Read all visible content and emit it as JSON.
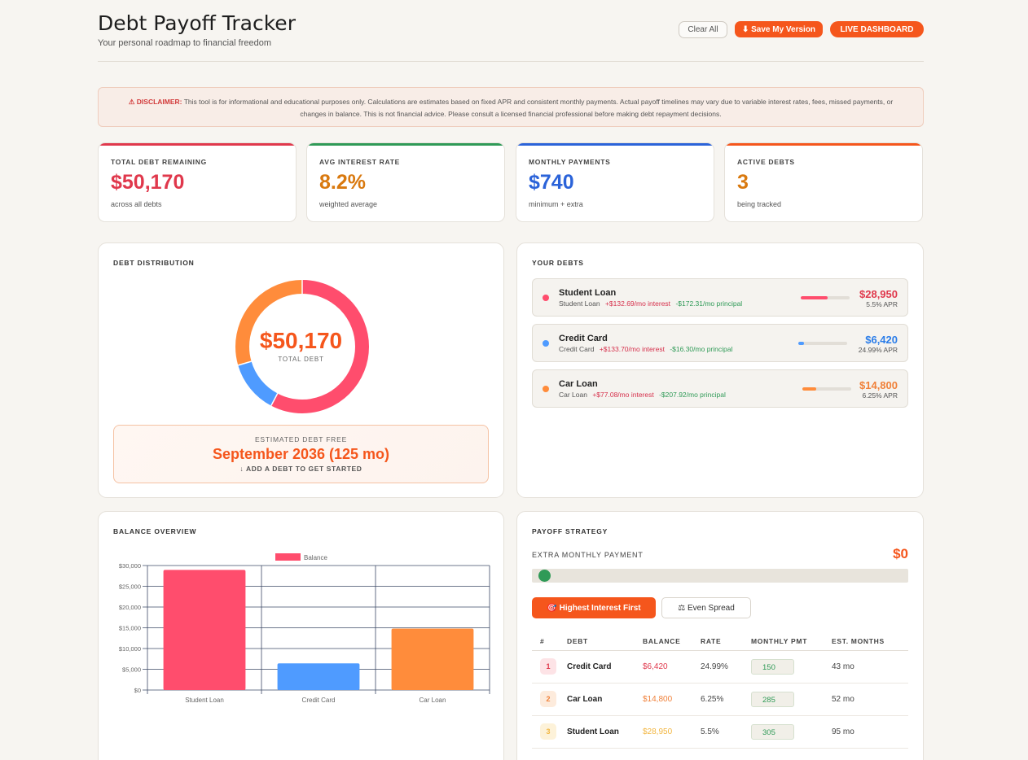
{
  "header": {
    "title": "Debt Payoff Tracker",
    "subtitle": "Your personal roadmap to financial freedom",
    "clear_label": "Clear All",
    "save_label": "⬇ Save My Version",
    "live_label": "LIVE DASHBOARD"
  },
  "disclaimer": {
    "lead": "⚠ DISCLAIMER:",
    "text": "This tool is for informational and educational purposes only. Calculations are estimates based on fixed APR and consistent monthly payments. Actual payoff timelines may vary due to variable interest rates, fees, missed payments, or changes in balance. This is not financial advice. Please consult a licensed financial professional before making debt repayment decisions."
  },
  "stats": [
    {
      "label": "TOTAL DEBT REMAINING",
      "value": "$50,170",
      "sub": "across all debts",
      "color": "#e0384c"
    },
    {
      "label": "AVG INTEREST RATE",
      "value": "8.2%",
      "sub": "weighted average",
      "color": "#d9790f"
    },
    {
      "label": "MONTHLY PAYMENTS",
      "value": "$740",
      "sub": "minimum + extra",
      "color": "#2b63d9"
    },
    {
      "label": "ACTIVE DEBTS",
      "value": "3",
      "sub": "being tracked",
      "color": "#d9790f"
    }
  ],
  "stat_bar_colors": [
    "#e0384c",
    "#2f9a57",
    "#2b63d9",
    "#f5561c"
  ],
  "distribution": {
    "title": "DEBT DISTRIBUTION",
    "center_value": "$50,170",
    "center_label": "TOTAL DEBT",
    "slices": [
      {
        "name": "Student Loan",
        "value": 28950,
        "color": "#ff4d6d"
      },
      {
        "name": "Credit Card",
        "value": 6420,
        "color": "#4f9bff"
      },
      {
        "name": "Car Loan",
        "value": 14800,
        "color": "#ff8c3b"
      }
    ],
    "debt_free_label": "ESTIMATED DEBT FREE",
    "debt_free_date": "September 2036 (125 mo)",
    "debt_free_hint": "↓ ADD A DEBT TO GET STARTED"
  },
  "your_debts": {
    "title": "YOUR DEBTS",
    "items": [
      {
        "name": "Student Loan",
        "type": "Student Loan",
        "interest": "+$132.69/mo interest",
        "principal": "-$172.31/mo principal",
        "balance": "$28,950",
        "apr": "5.5% APR",
        "color": "#ff4d6d",
        "progress": 0.55
      },
      {
        "name": "Credit Card",
        "type": "Credit Card",
        "interest": "+$133.70/mo interest",
        "principal": "-$16.30/mo principal",
        "balance": "$6,420",
        "apr": "24.99% APR",
        "color": "#4f9bff",
        "progress": 0.12
      },
      {
        "name": "Car Loan",
        "type": "Car Loan",
        "interest": "+$77.08/mo interest",
        "principal": "-$207.92/mo principal",
        "balance": "$14,800",
        "apr": "6.25% APR",
        "color": "#ff8c3b",
        "progress": 0.28
      }
    ]
  },
  "balance_overview": {
    "title": "BALANCE OVERVIEW"
  },
  "chart_data": {
    "type": "bar",
    "legend": "Balance",
    "categories": [
      "Student Loan",
      "Credit Card",
      "Car Loan"
    ],
    "values": [
      28950,
      6420,
      14800
    ],
    "colors": [
      "#ff4d6d",
      "#4f9bff",
      "#ff8c3b"
    ],
    "yticks": [
      "$0",
      "$5,000",
      "$10,000",
      "$15,000",
      "$20,000",
      "$25,000",
      "$30,000"
    ],
    "ylim": [
      0,
      30000
    ],
    "grid": true,
    "legend_position": "top-center"
  },
  "strategy": {
    "title": "PAYOFF STRATEGY",
    "extra_label": "EXTRA MONTHLY PAYMENT",
    "extra_value": "$0",
    "slider_level": 0,
    "btn_active": "🎯 Highest Interest First",
    "btn_inactive": "⚖ Even Spread",
    "columns": [
      "#",
      "DEBT",
      "BALANCE",
      "RATE",
      "MONTHLY PMT",
      "EST. MONTHS"
    ],
    "rows": [
      {
        "rank": "1",
        "debt": "Credit Card",
        "balance": "$6,420",
        "rate": "24.99%",
        "pmt": "150",
        "months": "43 mo",
        "rank_bg": "#fde3e6",
        "rank_color": "#e0384c",
        "bal_color": "#e0384c"
      },
      {
        "rank": "2",
        "debt": "Car Loan",
        "balance": "$14,800",
        "rate": "6.25%",
        "pmt": "285",
        "months": "52 mo",
        "rank_bg": "#fdebdc",
        "rank_color": "#f0813a",
        "bal_color": "#f0813a"
      },
      {
        "rank": "3",
        "debt": "Student Loan",
        "balance": "$28,950",
        "rate": "5.5%",
        "pmt": "305",
        "months": "95 mo",
        "rank_bg": "#fdf2d9",
        "rank_color": "#f2b640",
        "bal_color": "#f2b640"
      }
    ]
  }
}
